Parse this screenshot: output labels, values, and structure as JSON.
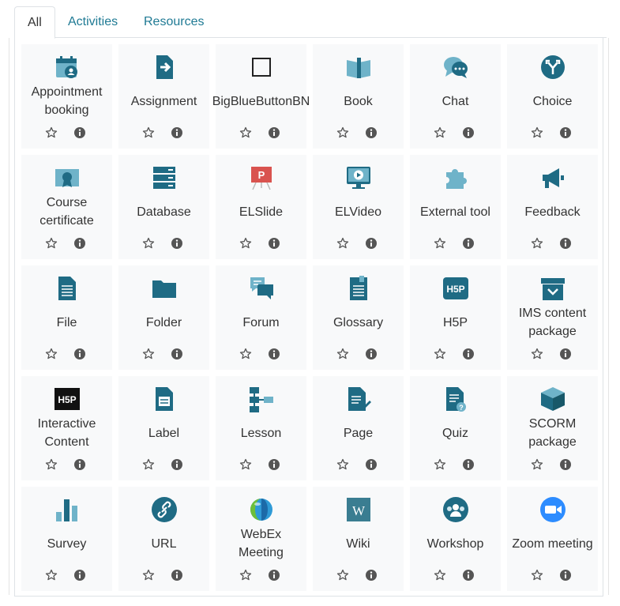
{
  "tabs": [
    {
      "label": "All",
      "active": true
    },
    {
      "label": "Activities",
      "active": false
    },
    {
      "label": "Resources",
      "active": false
    }
  ],
  "colors": {
    "icon": "#1f6b84",
    "icon_light": "#6fb3c9",
    "tab_link": "#1f7a94",
    "card_bg": "#f8f9fa"
  },
  "modules": [
    {
      "name": "Appointment booking",
      "icon": "calendar-person-icon"
    },
    {
      "name": "Assignment",
      "icon": "assignment-icon"
    },
    {
      "name": "BigBlueButtonBN",
      "icon": "square-outline-icon"
    },
    {
      "name": "Book",
      "icon": "book-icon"
    },
    {
      "name": "Chat",
      "icon": "chat-icon"
    },
    {
      "name": "Choice",
      "icon": "choice-icon"
    },
    {
      "name": "Course certificate",
      "icon": "certificate-icon"
    },
    {
      "name": "Database",
      "icon": "database-icon"
    },
    {
      "name": "ELSlide",
      "icon": "presentation-icon"
    },
    {
      "name": "ELVideo",
      "icon": "video-monitor-icon"
    },
    {
      "name": "External tool",
      "icon": "puzzle-icon"
    },
    {
      "name": "Feedback",
      "icon": "megaphone-icon"
    },
    {
      "name": "File",
      "icon": "file-icon"
    },
    {
      "name": "Folder",
      "icon": "folder-icon"
    },
    {
      "name": "Forum",
      "icon": "forum-icon"
    },
    {
      "name": "Glossary",
      "icon": "glossary-icon"
    },
    {
      "name": "H5P",
      "icon": "h5p-icon"
    },
    {
      "name": "IMS content package",
      "icon": "package-box-icon"
    },
    {
      "name": "Interactive Content",
      "icon": "h5p-black-icon"
    },
    {
      "name": "Label",
      "icon": "label-icon"
    },
    {
      "name": "Lesson",
      "icon": "lesson-icon"
    },
    {
      "name": "Page",
      "icon": "page-icon"
    },
    {
      "name": "Quiz",
      "icon": "quiz-icon"
    },
    {
      "name": "SCORM package",
      "icon": "scorm-cube-icon"
    },
    {
      "name": "Survey",
      "icon": "bar-chart-icon"
    },
    {
      "name": "URL",
      "icon": "link-icon"
    },
    {
      "name": "WebEx Meeting",
      "icon": "webex-globe-icon"
    },
    {
      "name": "Wiki",
      "icon": "wiki-icon"
    },
    {
      "name": "Workshop",
      "icon": "workshop-icon"
    },
    {
      "name": "Zoom meeting",
      "icon": "zoom-camera-icon"
    }
  ]
}
